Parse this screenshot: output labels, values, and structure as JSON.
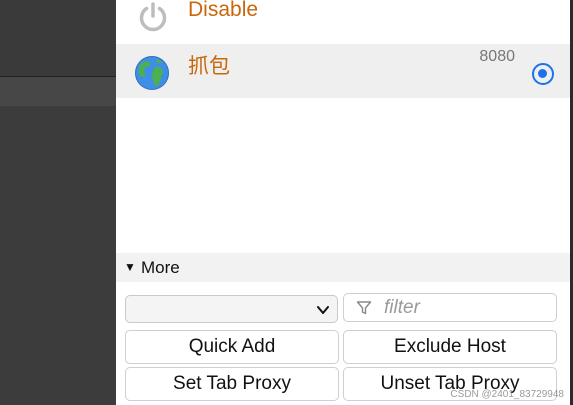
{
  "proxies": [
    {
      "name": "Disable",
      "icon": "power-icon",
      "port": "",
      "selected": false
    },
    {
      "name": "抓包",
      "icon": "globe-icon",
      "port": "8080",
      "selected": true
    }
  ],
  "more": {
    "arrow": "▼",
    "label": "More"
  },
  "controls": {
    "select_value": "",
    "filter_placeholder": "filter",
    "filter_value": ""
  },
  "buttons": {
    "quick_add": "Quick Add",
    "exclude_host": "Exclude Host",
    "set_tab_proxy": "Set Tab Proxy",
    "unset_tab_proxy": "Unset Tab Proxy"
  },
  "watermark": "CSDN @2401_83729948",
  "colors": {
    "proxy_name": "#c8670b",
    "accent": "#1a73e8",
    "selected_row": "#efefef"
  }
}
